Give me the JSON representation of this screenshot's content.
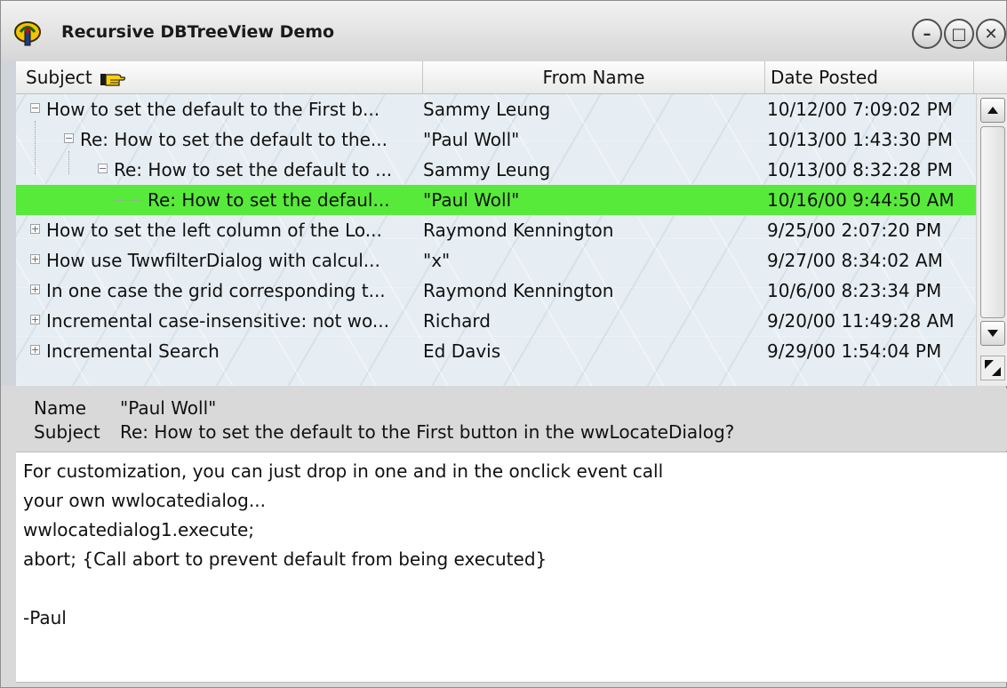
{
  "window": {
    "title": "Recursive DBTreeView Demo",
    "minimize_glyph": "–",
    "maximize_glyph": "□",
    "close_glyph": "✕",
    "icon": "app-icon"
  },
  "grid": {
    "columns": [
      "Subject",
      "From Name",
      "Date Posted"
    ],
    "subject_header_icon": "pointing-hand-icon",
    "rows": [
      {
        "subject": "How to set the default to the First b...",
        "from": "Sammy Leung",
        "date": "10/12/00 7:09:02 PM",
        "level": 0,
        "expander": "−",
        "selected": false
      },
      {
        "subject": "Re: How to set the default to the...",
        "from": "\"Paul Woll\"",
        "date": "10/13/00 1:43:30 PM",
        "level": 1,
        "expander": "−",
        "selected": false
      },
      {
        "subject": "Re: How to set the default to ...",
        "from": "Sammy Leung",
        "date": "10/13/00 8:32:28 PM",
        "level": 2,
        "expander": "−",
        "selected": false
      },
      {
        "subject": "Re: How to set the defaul...",
        "from": "\"Paul Woll\"",
        "date": "10/16/00 9:44:50 AM",
        "level": 3,
        "expander": "",
        "selected": true
      },
      {
        "subject": "How to set the left column of the Lo...",
        "from": "Raymond Kennington",
        "date": "9/25/00 2:07:20 PM",
        "level": 0,
        "expander": "+",
        "selected": false
      },
      {
        "subject": "How use TwwfilterDialog with calcul...",
        "from": "\"x\"",
        "date": "9/27/00 8:34:02 AM",
        "level": 0,
        "expander": "+",
        "selected": false
      },
      {
        "subject": "In one case the grid corresponding t...",
        "from": "Raymond Kennington",
        "date": "10/6/00 8:23:34 PM",
        "level": 0,
        "expander": "+",
        "selected": false
      },
      {
        "subject": "Incremental case-insensitive: not wo...",
        "from": "Richard",
        "date": "9/20/00 11:49:28 AM",
        "level": 0,
        "expander": "+",
        "selected": false
      },
      {
        "subject": "Incremental Search",
        "from": "Ed Davis",
        "date": "9/29/00 1:54:04 PM",
        "level": 0,
        "expander": "+",
        "selected": false
      }
    ],
    "selected_color": "#58ea3b"
  },
  "detail": {
    "name_label": "Name",
    "name_value": "\"Paul Woll\"",
    "subject_label": "Subject",
    "subject_value": "Re: How to set the default to the First button in the wwLocateDialog?"
  },
  "memo": {
    "lines": [
      "For customization, you can just drop in one and in the onclick event call",
      "your own wwlocatedialog...",
      "wwlocatedialog1.execute;",
      "abort;  {Call abort to prevent default from being executed}",
      "",
      "-Paul"
    ]
  }
}
